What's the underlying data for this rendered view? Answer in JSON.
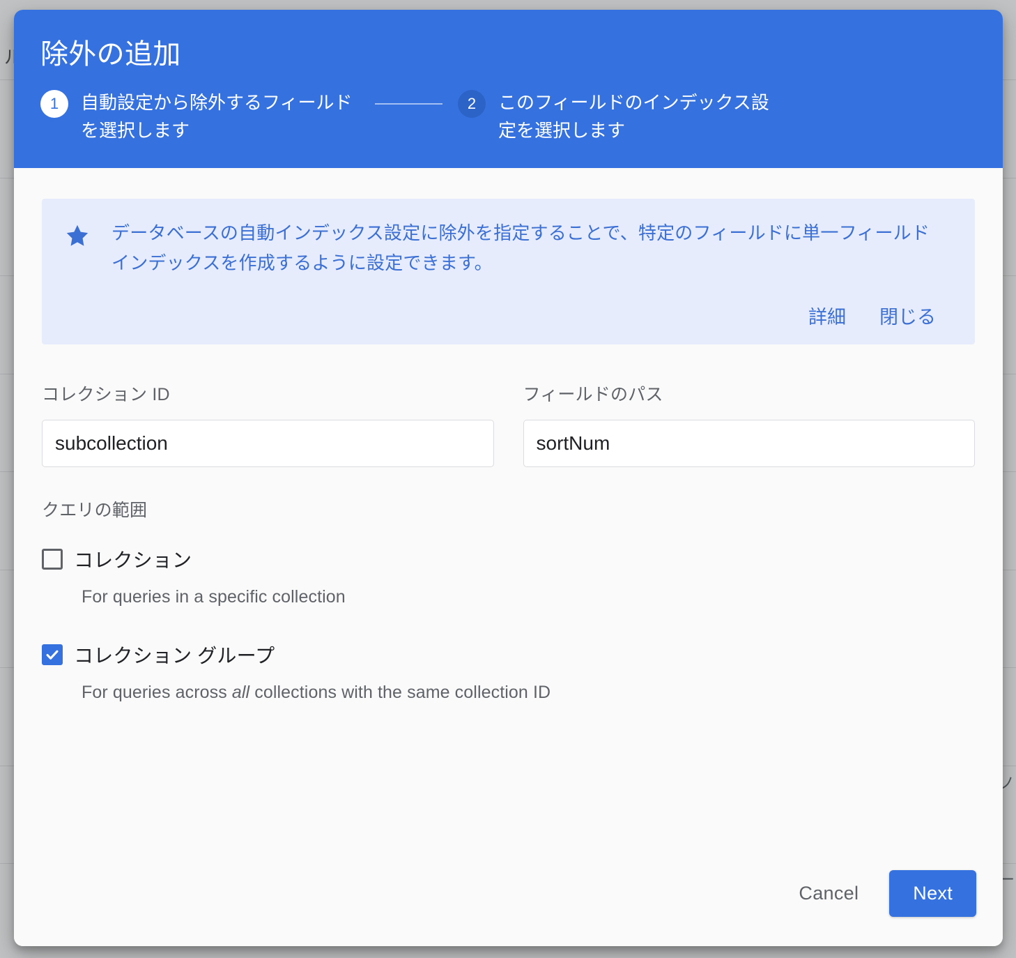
{
  "background": {
    "left_fragment": "ル",
    "right_fragments": [
      "ノ",
      "ー"
    ]
  },
  "dialog": {
    "title": "除外の追加",
    "stepper": {
      "steps": [
        {
          "number": "1",
          "label": "自動設定から除外するフィールドを選択します",
          "state": "active"
        },
        {
          "number": "2",
          "label": "このフィールドのインデックス設定を選択します",
          "state": "inactive"
        }
      ]
    },
    "banner": {
      "icon": "star-icon",
      "text": "データベースの自動インデックス設定に除外を指定することで、特定のフィールドに単一フィールド インデックスを作成するように設定できます。",
      "details_label": "詳細",
      "dismiss_label": "閉じる",
      "background_color": "#E6ECFB",
      "text_color": "#3B6FD4"
    },
    "fields": {
      "collection_id": {
        "label": "コレクション ID",
        "value": "subcollection",
        "placeholder": ""
      },
      "field_path": {
        "label": "フィールドのパス",
        "value": "sortNum",
        "placeholder": ""
      }
    },
    "query_scope": {
      "legend": "クエリの範囲",
      "options": [
        {
          "label": "コレクション",
          "hint_before": "For queries in a specific collection",
          "hint_italic": "",
          "hint_after": "",
          "checked": false
        },
        {
          "label": "コレクション グループ",
          "hint_before": "For queries across ",
          "hint_italic": "all",
          "hint_after": " collections with the same collection ID",
          "checked": true
        }
      ]
    },
    "footer": {
      "cancel_label": "Cancel",
      "next_label": "Next"
    },
    "colors": {
      "header_blue": "#3572E0",
      "step_inactive_blue": "#2C63C6",
      "primary_button": "#3572E0",
      "body_background": "#FAFAFA"
    }
  }
}
